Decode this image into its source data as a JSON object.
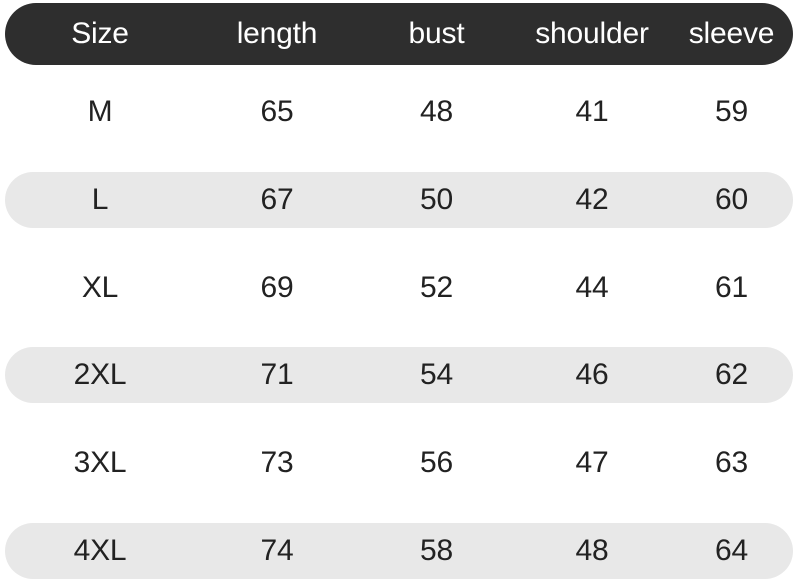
{
  "table": {
    "headers": [
      {
        "key": "size",
        "label": "Size"
      },
      {
        "key": "length",
        "label": "length"
      },
      {
        "key": "bust",
        "label": "bust"
      },
      {
        "key": "shoulder",
        "label": "shoulder"
      },
      {
        "key": "sleeve",
        "label": "sleeve"
      }
    ],
    "rows": [
      {
        "size": "M",
        "length": "65",
        "bust": "48",
        "shoulder": "41",
        "sleeve": "59",
        "striped": false
      },
      {
        "size": "L",
        "length": "67",
        "bust": "50",
        "shoulder": "42",
        "sleeve": "60",
        "striped": true
      },
      {
        "size": "XL",
        "length": "69",
        "bust": "52",
        "shoulder": "44",
        "sleeve": "61",
        "striped": false
      },
      {
        "size": "2XL",
        "length": "71",
        "bust": "54",
        "shoulder": "46",
        "sleeve": "62",
        "striped": true
      },
      {
        "size": "3XL",
        "length": "73",
        "bust": "56",
        "shoulder": "47",
        "sleeve": "63",
        "striped": false
      },
      {
        "size": "4XL",
        "length": "74",
        "bust": "58",
        "shoulder": "48",
        "sleeve": "64",
        "striped": true
      }
    ]
  },
  "colors": {
    "header_background": "#2e2e2e",
    "header_text": "#ffffff",
    "stripe_background": "#e8e8e8",
    "page_background": "#ffffff",
    "body_text": "#222222"
  }
}
